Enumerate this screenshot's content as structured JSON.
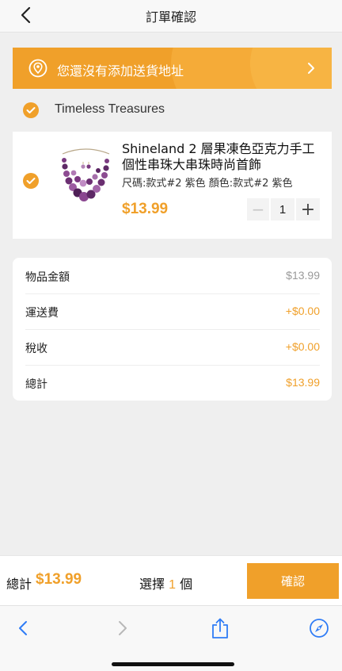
{
  "header": {
    "title": "訂單確認"
  },
  "address_banner": {
    "text": "您還沒有添加送貨地址"
  },
  "store": {
    "name": "Timeless Treasures"
  },
  "product": {
    "title": "Shineland 2 層果凍色亞克力手工個性串珠大串珠時尚首飾",
    "variant": "尺碼:款式#2 紫色   顏色:款式#2 紫色",
    "price": "$13.99",
    "quantity": "1",
    "minus_symbol": "−",
    "plus_symbol": "+"
  },
  "summary": {
    "items": [
      {
        "label": "物品金額",
        "value": "$13.99",
        "color": "#9a9a9a"
      },
      {
        "label": "運送費",
        "value": "+$0.00",
        "color": "#f0a02a"
      },
      {
        "label": "稅收",
        "value": "+$0.00",
        "color": "#f0a02a"
      },
      {
        "label": "總計",
        "value": "$13.99",
        "color": "#f0a02a"
      }
    ]
  },
  "bottom_bar": {
    "total_label": "總計",
    "total_value": "$13.99",
    "select_prefix": "選擇",
    "select_count": "1",
    "select_suffix": "個",
    "confirm_label": "確認"
  },
  "colors": {
    "accent": "#f0a02a",
    "browser_icon": "#2f7cf6"
  },
  "icons": [
    "back-icon",
    "location-pin-icon",
    "chevron-right-icon",
    "checkmark-icon",
    "browser-back-icon",
    "browser-forward-icon",
    "share-icon",
    "compass-icon"
  ]
}
